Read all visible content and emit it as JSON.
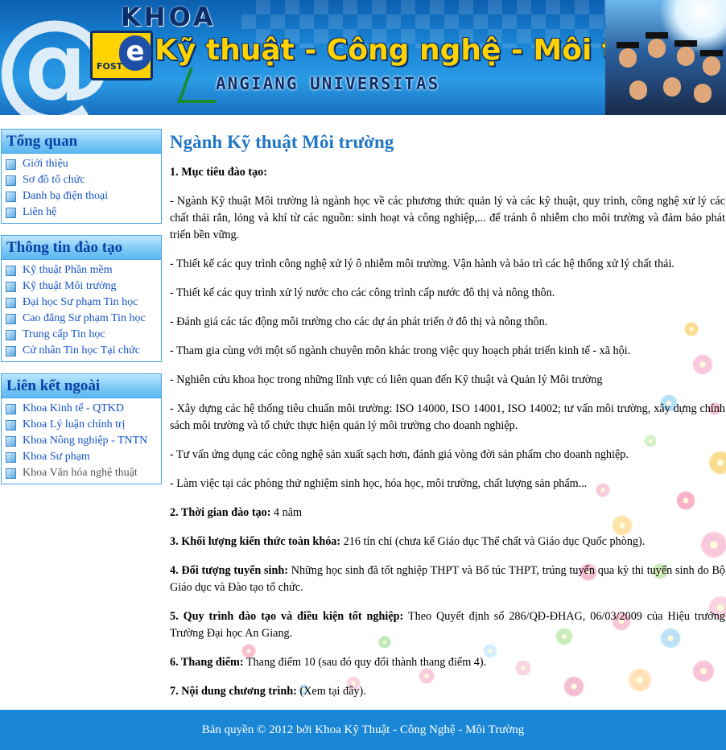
{
  "header": {
    "khoa": "KHOA",
    "logo_fost": "FOST",
    "logo_letter": "e",
    "title": "Kỹ thuật - Công nghệ - Môi trường",
    "university": "ANGIANG UNIVERSITAS"
  },
  "sidebar": {
    "sections": [
      {
        "title": "Tổng quan",
        "items": [
          "Giới thiệu",
          "Sơ đồ tổ chức",
          "Danh bạ điện thoại",
          "Liên hệ"
        ]
      },
      {
        "title": "Thông tin đào tạo",
        "items": [
          "Kỹ thuật Phần mềm",
          "Kỹ thuật Môi trường",
          "Đại học Sư phạm Tin học",
          "Cao đẳng Sư phạm Tin học",
          "Trung cấp Tin học",
          "Cử nhân Tin học Tại chức"
        ]
      },
      {
        "title": "Liên kết ngoài",
        "items": [
          "Khoa Kinh tế - QTKD",
          "Khoa Lý luận chính trị",
          "Khoa Nông nghiệp - TNTN",
          "Khoa Sư phạm",
          "Khoa Văn hóa nghệ thuật"
        ]
      }
    ]
  },
  "main": {
    "title": "Ngành Kỹ thuật Môi trường",
    "objective_heading": "1. Mục tiêu đào tạo:",
    "objectives": [
      "- Ngành Kỹ thuật Môi trường là ngành học về các phương thức quản lý và các kỹ thuật, quy trình, công nghệ xử lý các chất thải rắn, lỏng và khí từ các nguồn: sinh hoạt và công nghiệp,... để tránh ô nhiễm cho môi trường và đảm bảo phát triển bền vững.",
      "- Thiết kế các quy trình công nghệ xử lý ô nhiễm môi trường. Vận hành và bảo trì các hệ thống xử lý chất thải.",
      "- Thiết kế các quy trình xử lý nước cho các công trình cấp nước đô thị và nông thôn.",
      "- Đánh giá các tác động môi trường cho các dự án phát triển ở đô thị và nông thôn.",
      "- Tham gia cùng với một số ngành chuyên môn khác trong việc quy hoạch phát triển kinh tế - xã hội.",
      "- Nghiên cứu khoa học trong những lĩnh vực có liên quan đến Kỹ thuật và Quản lý Môi trường",
      "- Xây dựng các hệ thống tiêu chuẩn môi trường: ISO 14000, ISO 14001, ISO 14002; tư vấn môi trường, xây dựng chính sách môi trường và tổ chức thực hiện quản lý môi trường cho doanh nghiệp.",
      "- Tư vấn ứng dụng các công nghệ sản xuất sạch hơn, đánh giá vòng đời sản phẩm cho doanh nghiệp.",
      "- Làm việc tại các phòng thử nghiệm sinh học, hóa học, môi trường, chất lượng sản phẩm..."
    ],
    "items": [
      {
        "label": "2. Thời gian đào tạo:",
        "text": " 4 năm"
      },
      {
        "label": "3. Khối lượng kiến thức toàn khóa:",
        "text": " 216 tín chỉ (chưa kể Giáo dục Thể chất và Giáo dục Quốc phòng)."
      },
      {
        "label": "4. Đối tượng tuyển sinh:",
        "text": " Những học sinh đã tốt nghiệp THPT và Bổ túc THPT, trúng tuyển qua kỳ thi tuyển sinh do Bộ Giáo dục và Đào tạo tổ chức."
      },
      {
        "label": "5. Quy trình đào tạo và điều kiện tốt nghiệp:",
        "text": " Theo Quyết định số 286/QĐ-ĐHAG, 06/03/2009 của Hiệu trưởng Trường Đại học An Giang."
      },
      {
        "label": "6. Thang điểm:",
        "text": " Thang điểm 10 (sau đó quy đổi thành thang điểm 4)."
      },
      {
        "label": "7. Nội dung chương trình:",
        "text": " (Xem tại đây)."
      }
    ]
  },
  "footer": {
    "text": "Bản quyền © 2012 bởi Khoa Kỹ Thuật - Công Nghệ - Môi Trường"
  },
  "colors": {
    "accent": "#1a86d6",
    "title_blue": "#2277c4",
    "link_blue": "#1452c8",
    "header_title_yellow": "#ffd200"
  }
}
